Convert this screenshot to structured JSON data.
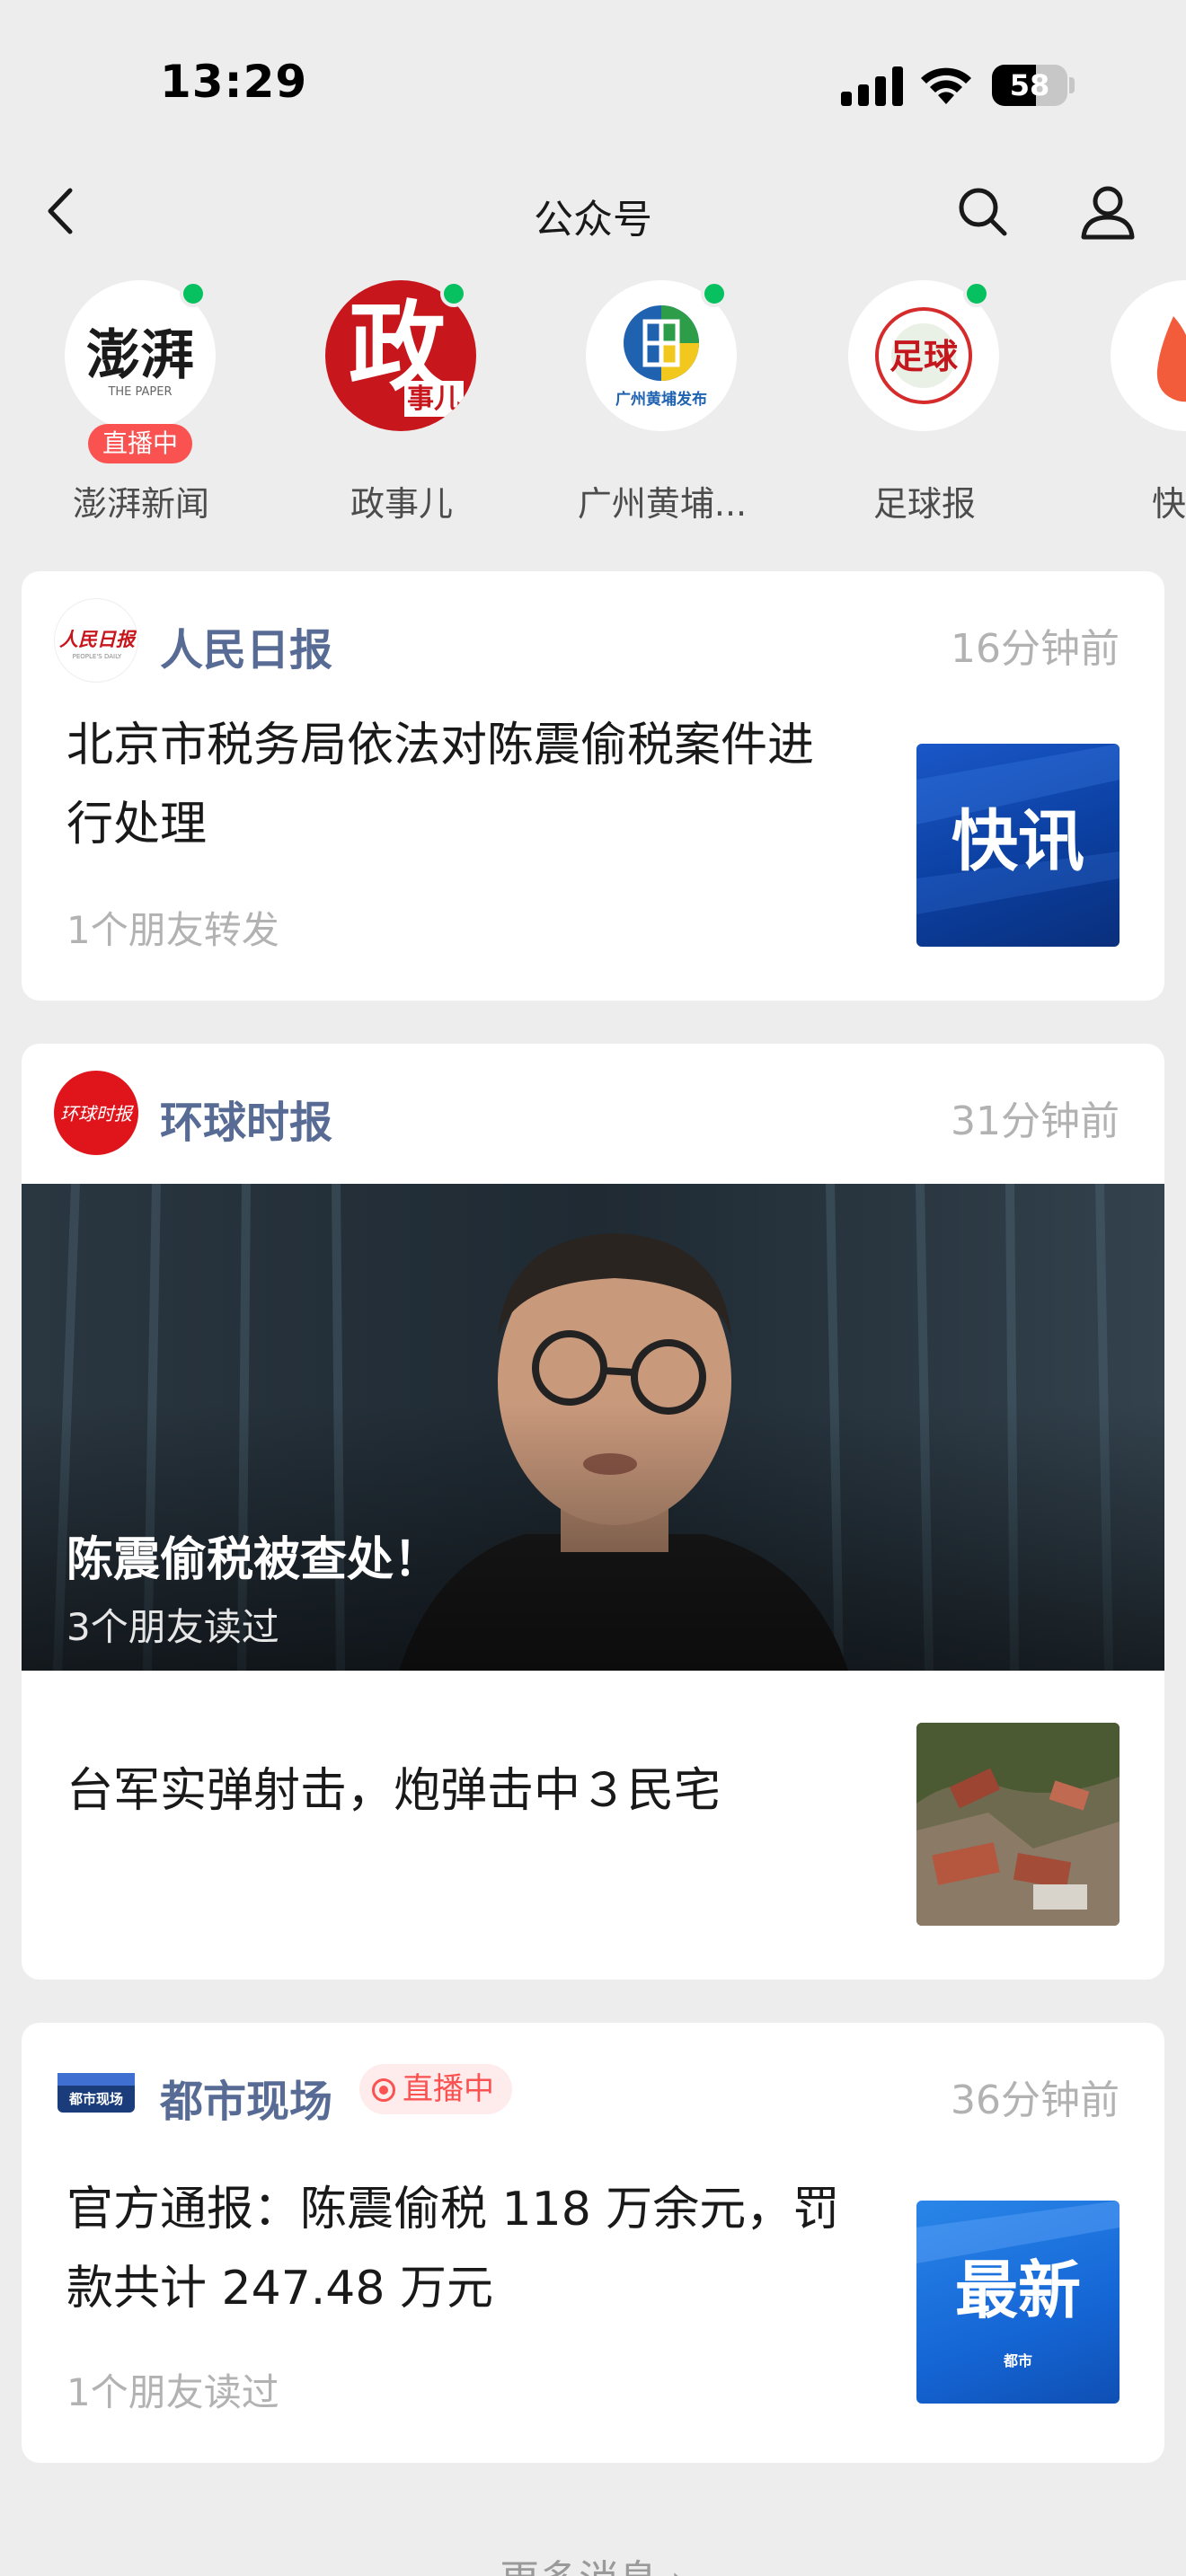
{
  "status_bar": {
    "time": "13:29",
    "battery_level": "58",
    "battery_fraction": 0.58
  },
  "header": {
    "title": "公众号"
  },
  "accounts": [
    {
      "name": "澎湃新闻",
      "live_label": "直播中",
      "logo_text": "澎湃",
      "logo_subtext": "THE PAPER"
    },
    {
      "name": "政事儿",
      "logo_text": "政",
      "logo_subtext": "事儿"
    },
    {
      "name": "广州黄埔...",
      "logo_subtext": "广州黄埔发布"
    },
    {
      "name": "足球报",
      "logo_text": "足球"
    },
    {
      "name": "快"
    }
  ],
  "feed": [
    {
      "source": "人民日报",
      "source_logo_text": "人民日报",
      "source_logo_subtext": "PEOPLE'S DAILY",
      "time": "16分钟前",
      "articles": [
        {
          "title_line1": "北京市税务局依法对陈震偷税案件进",
          "title_line2": "行处理",
          "subtitle": "1个朋友转发",
          "thumb_text": "快讯"
        }
      ]
    },
    {
      "source": "环球时报",
      "source_logo_text": "环球时报",
      "time": "31分钟前",
      "hero": {
        "title": "陈震偷税被查处！",
        "subtitle": "3个朋友读过"
      },
      "articles": [
        {
          "title": "台军实弹射击，炮弹击中３民宅"
        }
      ]
    },
    {
      "source": "都市现场",
      "source_logo_text": "都市现场",
      "live_label": "直播中",
      "time": "36分钟前",
      "articles": [
        {
          "title_line1": "官方通报：陈震偷税 118 万余元，罚",
          "title_line2": "款共计 247.48 万元",
          "subtitle": "1个朋友读过",
          "thumb_text": "最新",
          "thumb_subtext": "都市"
        }
      ]
    }
  ],
  "footer": {
    "more_label": "更多消息 ›"
  }
}
